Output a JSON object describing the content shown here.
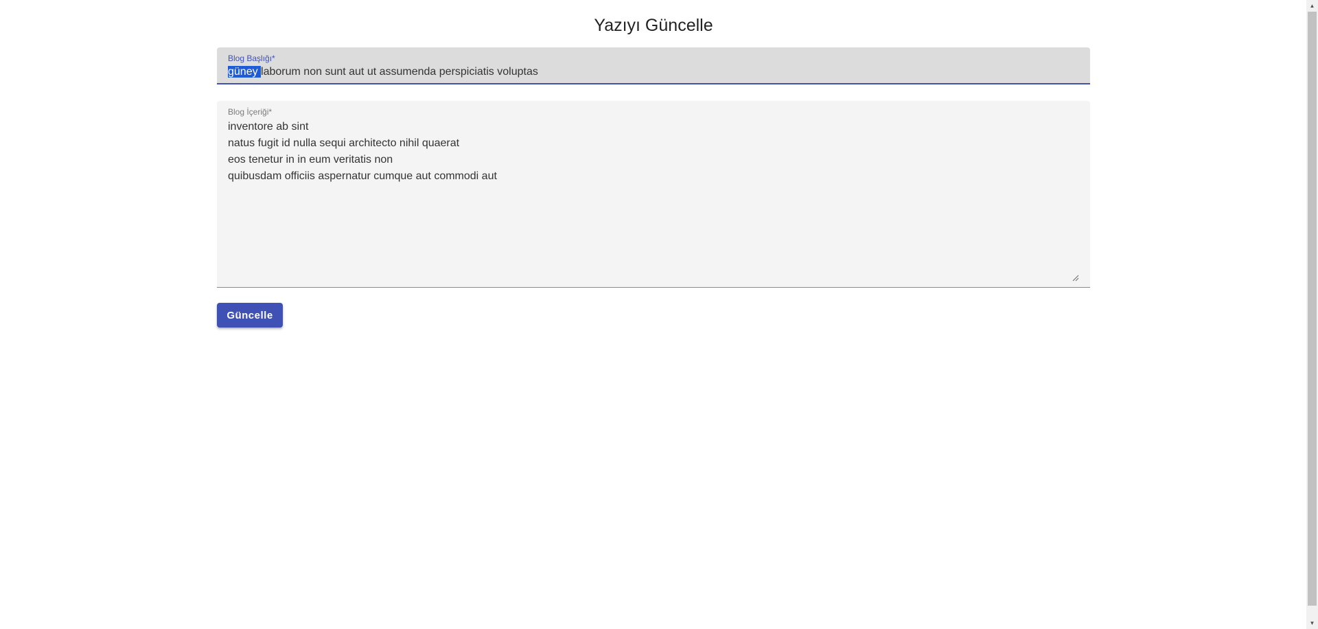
{
  "page": {
    "title": "Yazıyı Güncelle"
  },
  "form": {
    "title_field": {
      "label": "Blog Başlığı*",
      "value_selected": "güney ",
      "value_rest": "laborum non sunt aut ut assumenda perspiciatis voluptas"
    },
    "content_field": {
      "label": "Blog İçeriği*",
      "lines": [
        "inventore ab sint",
        "natus fugit id nulla sequi architecto nihil quaerat",
        "eos tenetur in in eum veritatis non",
        "quibusdam officiis aspernatur cumque aut commodi aut"
      ]
    },
    "submit_label": "Güncelle"
  },
  "colors": {
    "accent": "#3f51b5",
    "selection": "#1e5bd6",
    "title_field_bg": "#dcdcdc",
    "content_field_bg": "#f4f4f4"
  },
  "icons": {
    "resize_handle": "resize-grip-icon",
    "scroll_up": "triangle-up-icon",
    "scroll_down": "triangle-down-icon"
  }
}
